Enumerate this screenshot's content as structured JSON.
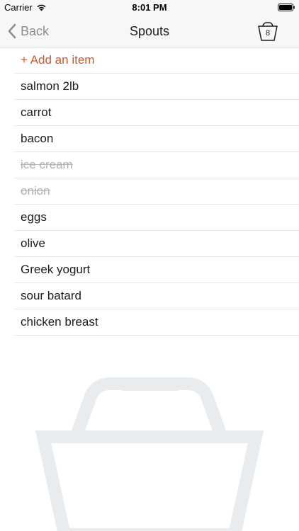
{
  "status_bar": {
    "carrier": "Carrier",
    "time": "8:01 PM"
  },
  "nav": {
    "back_label": "Back",
    "title": "Spouts",
    "basket_count": "8"
  },
  "list": {
    "add_label": "+ Add an item",
    "items": [
      {
        "label": "salmon 2lb",
        "done": false
      },
      {
        "label": "carrot",
        "done": false
      },
      {
        "label": "bacon",
        "done": false
      },
      {
        "label": "ice cream",
        "done": true
      },
      {
        "label": "onion",
        "done": true
      },
      {
        "label": "eggs",
        "done": false
      },
      {
        "label": "olive",
        "done": false
      },
      {
        "label": "Greek yogurt",
        "done": false
      },
      {
        "label": "sour batard",
        "done": false
      },
      {
        "label": "chicken breast",
        "done": false
      }
    ]
  },
  "colors": {
    "accent": "#d2572a",
    "done_text": "#b0b0b0",
    "basket_watermark": "#e9ecef"
  }
}
